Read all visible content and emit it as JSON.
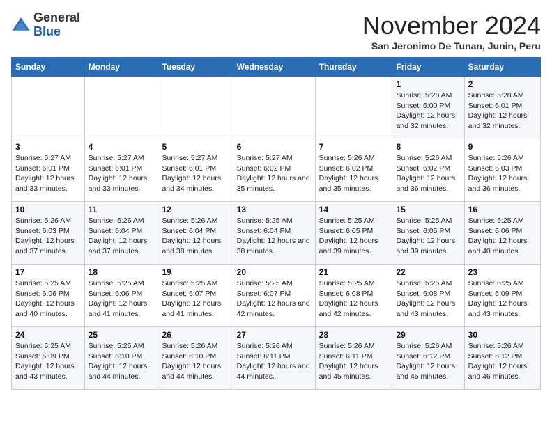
{
  "header": {
    "logo_general": "General",
    "logo_blue": "Blue",
    "month_title": "November 2024",
    "location": "San Jeronimo De Tunan, Junin, Peru"
  },
  "weekdays": [
    "Sunday",
    "Monday",
    "Tuesday",
    "Wednesday",
    "Thursday",
    "Friday",
    "Saturday"
  ],
  "weeks": [
    [
      {
        "day": "",
        "sunrise": "",
        "sunset": "",
        "daylight": ""
      },
      {
        "day": "",
        "sunrise": "",
        "sunset": "",
        "daylight": ""
      },
      {
        "day": "",
        "sunrise": "",
        "sunset": "",
        "daylight": ""
      },
      {
        "day": "",
        "sunrise": "",
        "sunset": "",
        "daylight": ""
      },
      {
        "day": "",
        "sunrise": "",
        "sunset": "",
        "daylight": ""
      },
      {
        "day": "1",
        "sunrise": "5:28 AM",
        "sunset": "6:00 PM",
        "daylight": "12 hours and 32 minutes."
      },
      {
        "day": "2",
        "sunrise": "5:28 AM",
        "sunset": "6:01 PM",
        "daylight": "12 hours and 32 minutes."
      }
    ],
    [
      {
        "day": "3",
        "sunrise": "5:27 AM",
        "sunset": "6:01 PM",
        "daylight": "12 hours and 33 minutes."
      },
      {
        "day": "4",
        "sunrise": "5:27 AM",
        "sunset": "6:01 PM",
        "daylight": "12 hours and 33 minutes."
      },
      {
        "day": "5",
        "sunrise": "5:27 AM",
        "sunset": "6:01 PM",
        "daylight": "12 hours and 34 minutes."
      },
      {
        "day": "6",
        "sunrise": "5:27 AM",
        "sunset": "6:02 PM",
        "daylight": "12 hours and 35 minutes."
      },
      {
        "day": "7",
        "sunrise": "5:26 AM",
        "sunset": "6:02 PM",
        "daylight": "12 hours and 35 minutes."
      },
      {
        "day": "8",
        "sunrise": "5:26 AM",
        "sunset": "6:02 PM",
        "daylight": "12 hours and 36 minutes."
      },
      {
        "day": "9",
        "sunrise": "5:26 AM",
        "sunset": "6:03 PM",
        "daylight": "12 hours and 36 minutes."
      }
    ],
    [
      {
        "day": "10",
        "sunrise": "5:26 AM",
        "sunset": "6:03 PM",
        "daylight": "12 hours and 37 minutes."
      },
      {
        "day": "11",
        "sunrise": "5:26 AM",
        "sunset": "6:04 PM",
        "daylight": "12 hours and 37 minutes."
      },
      {
        "day": "12",
        "sunrise": "5:26 AM",
        "sunset": "6:04 PM",
        "daylight": "12 hours and 38 minutes."
      },
      {
        "day": "13",
        "sunrise": "5:25 AM",
        "sunset": "6:04 PM",
        "daylight": "12 hours and 38 minutes."
      },
      {
        "day": "14",
        "sunrise": "5:25 AM",
        "sunset": "6:05 PM",
        "daylight": "12 hours and 39 minutes."
      },
      {
        "day": "15",
        "sunrise": "5:25 AM",
        "sunset": "6:05 PM",
        "daylight": "12 hours and 39 minutes."
      },
      {
        "day": "16",
        "sunrise": "5:25 AM",
        "sunset": "6:06 PM",
        "daylight": "12 hours and 40 minutes."
      }
    ],
    [
      {
        "day": "17",
        "sunrise": "5:25 AM",
        "sunset": "6:06 PM",
        "daylight": "12 hours and 40 minutes."
      },
      {
        "day": "18",
        "sunrise": "5:25 AM",
        "sunset": "6:06 PM",
        "daylight": "12 hours and 41 minutes."
      },
      {
        "day": "19",
        "sunrise": "5:25 AM",
        "sunset": "6:07 PM",
        "daylight": "12 hours and 41 minutes."
      },
      {
        "day": "20",
        "sunrise": "5:25 AM",
        "sunset": "6:07 PM",
        "daylight": "12 hours and 42 minutes."
      },
      {
        "day": "21",
        "sunrise": "5:25 AM",
        "sunset": "6:08 PM",
        "daylight": "12 hours and 42 minutes."
      },
      {
        "day": "22",
        "sunrise": "5:25 AM",
        "sunset": "6:08 PM",
        "daylight": "12 hours and 43 minutes."
      },
      {
        "day": "23",
        "sunrise": "5:25 AM",
        "sunset": "6:09 PM",
        "daylight": "12 hours and 43 minutes."
      }
    ],
    [
      {
        "day": "24",
        "sunrise": "5:25 AM",
        "sunset": "6:09 PM",
        "daylight": "12 hours and 43 minutes."
      },
      {
        "day": "25",
        "sunrise": "5:25 AM",
        "sunset": "6:10 PM",
        "daylight": "12 hours and 44 minutes."
      },
      {
        "day": "26",
        "sunrise": "5:26 AM",
        "sunset": "6:10 PM",
        "daylight": "12 hours and 44 minutes."
      },
      {
        "day": "27",
        "sunrise": "5:26 AM",
        "sunset": "6:11 PM",
        "daylight": "12 hours and 44 minutes."
      },
      {
        "day": "28",
        "sunrise": "5:26 AM",
        "sunset": "6:11 PM",
        "daylight": "12 hours and 45 minutes."
      },
      {
        "day": "29",
        "sunrise": "5:26 AM",
        "sunset": "6:12 PM",
        "daylight": "12 hours and 45 minutes."
      },
      {
        "day": "30",
        "sunrise": "5:26 AM",
        "sunset": "6:12 PM",
        "daylight": "12 hours and 46 minutes."
      }
    ]
  ],
  "labels": {
    "sunrise": "Sunrise:",
    "sunset": "Sunset:",
    "daylight": "Daylight:"
  }
}
